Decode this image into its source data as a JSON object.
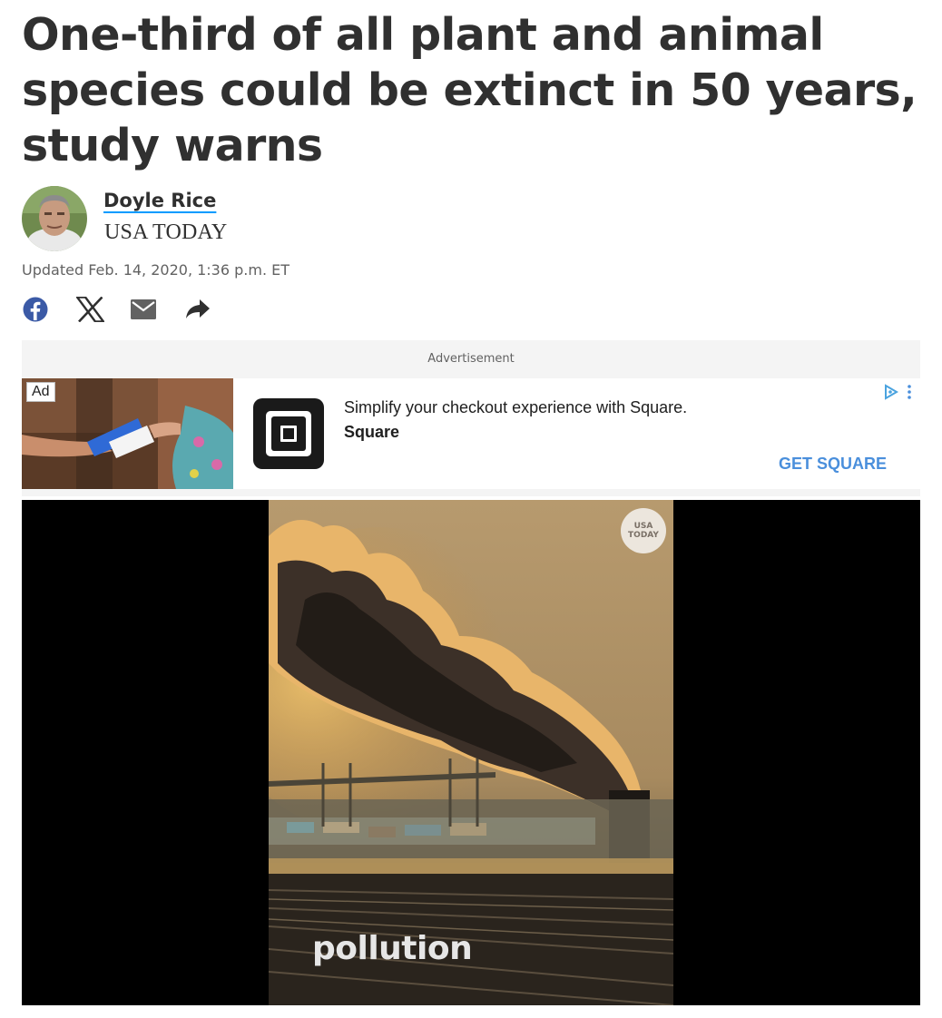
{
  "article": {
    "headline": "One-third of all plant and animal species could be extinct in 50 years, study warns",
    "author": "Doyle Rice",
    "publication": "USA TODAY",
    "dateline": "Updated Feb. 14, 2020, 1:36 p.m. ET"
  },
  "share": {
    "icons": [
      "facebook-icon",
      "x-icon",
      "email-icon",
      "share-arrow-icon"
    ],
    "colors": {
      "facebook": "#3b5aa6",
      "icon_default": "#303030",
      "email": "#626262"
    }
  },
  "ad": {
    "label": "Advertisement",
    "tag": "Ad",
    "text": "Simplify your checkout experience with Square.",
    "brand": "Square",
    "cta": "GET SQUARE",
    "cta_color": "#4a8fdc"
  },
  "video": {
    "caption": "pollution",
    "badge_line1": "USA",
    "badge_line2": "TODAY"
  },
  "colors": {
    "headline": "#303030",
    "author_underline": "#009bff",
    "meta": "#626262",
    "ad_bg": "#f4f4f4"
  }
}
